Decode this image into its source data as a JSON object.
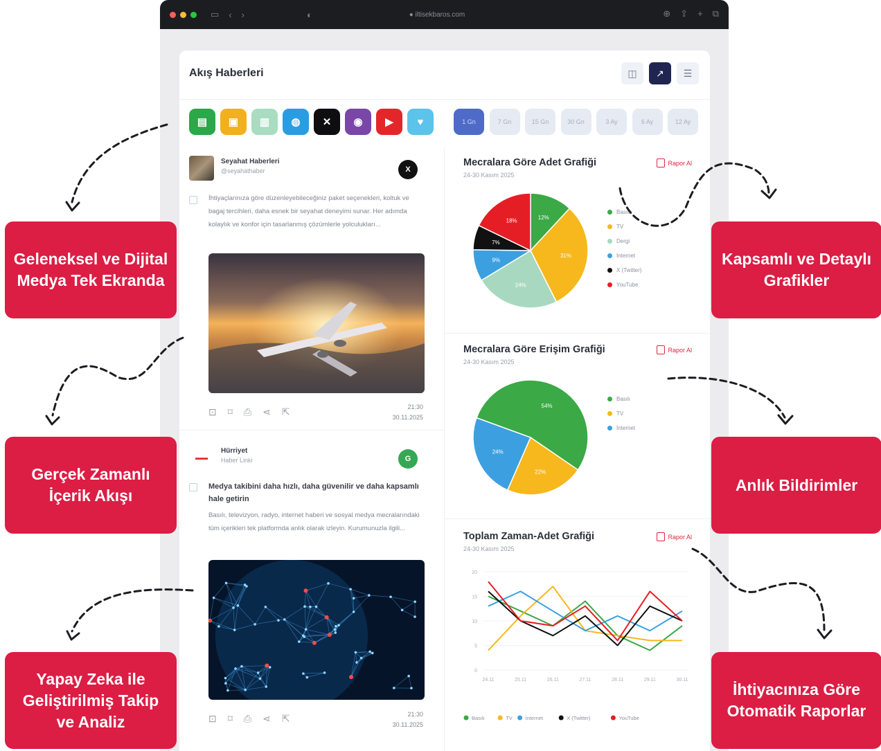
{
  "browser": {
    "url": "● iltisekbaros.com"
  },
  "app": {
    "title": "Akış Haberleri",
    "source_chips": [
      {
        "icon": "newspaper-icon",
        "glyph": "▤",
        "color": "#2aa84a"
      },
      {
        "icon": "tv-icon",
        "glyph": "▣",
        "color": "#f2b01e"
      },
      {
        "icon": "magazine-icon",
        "glyph": "▥",
        "color": "#a9dcc1"
      },
      {
        "icon": "internet-icon",
        "glyph": "◍",
        "color": "#2a9de2"
      },
      {
        "icon": "x-icon",
        "glyph": "✕",
        "color": "#0e0e10"
      },
      {
        "icon": "podcast-icon",
        "glyph": "◉",
        "color": "#7a46a8"
      },
      {
        "icon": "youtube-icon",
        "glyph": "▶",
        "color": "#e4262b"
      },
      {
        "icon": "social-icon",
        "glyph": "♥",
        "color": "#5cc3ea"
      }
    ],
    "date_ranges": [
      "1 Gn",
      "7 Gn",
      "15 Gn",
      "30 Gn",
      "3 Ay",
      "6 Ay",
      "12 Ay"
    ]
  },
  "feed": [
    {
      "source": "Seyahat Haberleri",
      "handle": "@seyahathaber",
      "badge": "X",
      "badge_color": "#111111",
      "headline": "",
      "text": "İhtiyaçlarınıza göre düzenleyebileceğiniz paket seçenekleri, koltuk ve bagaj tercihleri, daha esnek bir seyahat deneyimi sunar. Her adımda kolaylık ve konfor için tasarlanmış çözümlerle yolculukları...",
      "time": "21:30",
      "date": "30.11.2025"
    },
    {
      "source": "Hürriyet",
      "handle": "Haber Linki",
      "badge": "G",
      "badge_color": "#34a853",
      "headline": "Medya takibini daha hızlı, daha güvenilir ve daha kapsamlı hale getirin",
      "text": "Basılı, televizyon, radyo, internet haberi ve sosyal medya mecralarındaki tüm içerikleri tek platformda anlık olarak izleyin. Kurumunuzla ilgili...",
      "time": "21:30",
      "date": "30.11.2025"
    }
  ],
  "charts": {
    "report_label": "Rapor Al",
    "subtitle": "24-30 Kasım 2025",
    "count_title": "Mecralara Göre Adet Grafiği",
    "reach_title": "Mecralara Göre Erişim Grafiği",
    "time_title": "Toplam Zaman-Adet Grafiği"
  },
  "chart_data": [
    {
      "type": "pie",
      "title": "Mecralara Göre Adet Grafiği",
      "subtitle": "24-30 Kasım 2025",
      "slices": [
        {
          "name": "Basılı",
          "value": 12,
          "color": "#3aa946"
        },
        {
          "name": "TV",
          "value": 31,
          "color": "#f6b81c"
        },
        {
          "name": "Dergi",
          "value": 24,
          "color": "#a8d9c0"
        },
        {
          "name": "İnternet",
          "value": 9,
          "color": "#3c9fe0"
        },
        {
          "name": "X (Twitter)",
          "value": 7,
          "color": "#111111"
        },
        {
          "name": "YouTube",
          "value": 18,
          "color": "#e51e26"
        }
      ]
    },
    {
      "type": "pie",
      "title": "Mecralara Göre Erişim Grafiği",
      "subtitle": "24-30 Kasım 2025",
      "slices": [
        {
          "name": "Basılı",
          "value": 54,
          "color": "#3aa946"
        },
        {
          "name": "TV",
          "value": 22,
          "color": "#f6b81c"
        },
        {
          "name": "İnternet",
          "value": 24,
          "color": "#3c9fe0"
        }
      ]
    },
    {
      "type": "line",
      "title": "Toplam Zaman-Adet Grafiği",
      "subtitle": "24-30 Kasım 2025",
      "x": [
        "24.11",
        "25.11",
        "26.11",
        "27.11",
        "28.11",
        "29.11",
        "30.11"
      ],
      "y_ticks": [
        0,
        5,
        10,
        15,
        20
      ],
      "ylim": [
        0,
        20
      ],
      "series": [
        {
          "name": "Basılı",
          "color": "#3aa946",
          "values": [
            15,
            12,
            9,
            14,
            7,
            4,
            9
          ]
        },
        {
          "name": "TV",
          "color": "#f6b81c",
          "values": [
            4,
            11,
            17,
            8,
            7,
            6,
            6
          ]
        },
        {
          "name": "İnternet",
          "color": "#3c9fe0",
          "values": [
            13,
            16,
            12,
            8,
            11,
            8,
            12
          ]
        },
        {
          "name": "X (Twitter)",
          "color": "#111111",
          "values": [
            16,
            10,
            7,
            11,
            5,
            13,
            10
          ]
        },
        {
          "name": "YouTube",
          "color": "#e51e26",
          "values": [
            18,
            10,
            9,
            13,
            6,
            16,
            10
          ]
        }
      ]
    }
  ],
  "callouts": {
    "left_1": "Geleneksel ve Dijital Medya Tek Ekranda",
    "left_2": "Gerçek Zamanlı İçerik Akışı",
    "left_3": "Yapay Zeka ile Geliştirilmiş Takip ve Analiz",
    "right_1": "Kapsamlı ve Detaylı Grafikler",
    "right_2": "Anlık Bildirimler",
    "right_3": "İhtiyacınıza Göre Otomatik Raporlar"
  }
}
